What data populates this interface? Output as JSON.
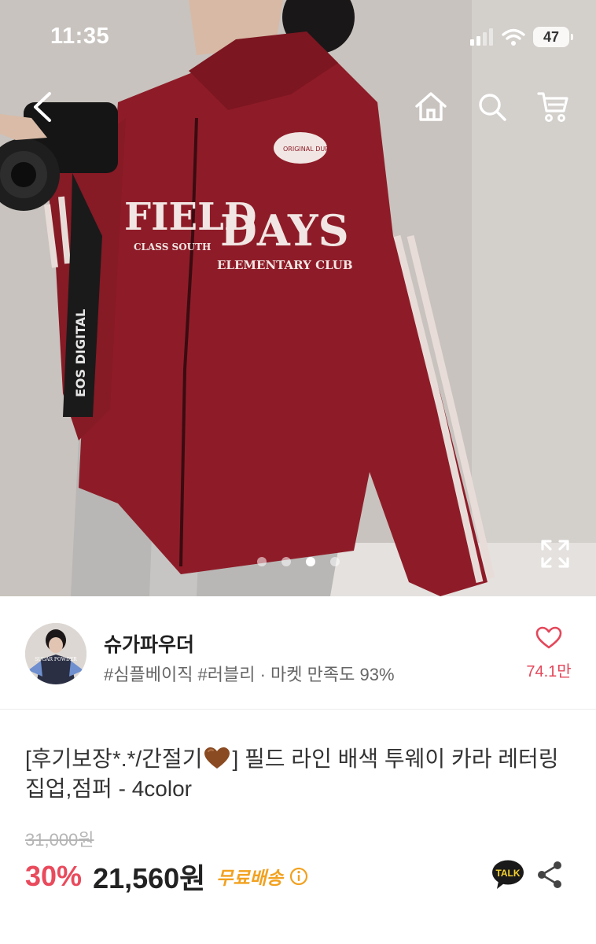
{
  "status_bar": {
    "time": "11:35",
    "battery": "47"
  },
  "product_image": {
    "carousel_total": 4,
    "carousel_active": 3,
    "jacket_text": {
      "left_chest": "FIELD",
      "right_chest": "DAYS",
      "right_sub": "ELEMENTARY CLUB",
      "left_sub": "CLASS SOUTH",
      "patch": "ORIGINAL DURABLE",
      "strap": "EOS DIGITAL"
    }
  },
  "seller": {
    "name": "슈가파우더",
    "meta": "#심플베이직 #러블리 · 마켓 만족도 93%",
    "avatar_caption": "SUGAR POWDER",
    "likes": "74.1만"
  },
  "product": {
    "title_part1": "[후기보장*.*/간절기",
    "title_part2": "] 필드 라인 배색 투웨이 카라 레터링 집업,점퍼 - 4color",
    "original_price": "31,000원",
    "discount": "30%",
    "price": "21,560원",
    "shipping": "무료배송",
    "talk_label": "TALK"
  },
  "colors": {
    "discount": "#e94a5c",
    "shipping": "#f2a11f",
    "like": "#e4475a",
    "jacket": "#8e1c28"
  }
}
